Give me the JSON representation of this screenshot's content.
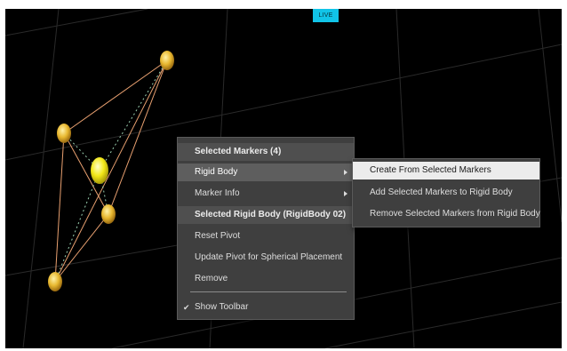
{
  "viewport": {
    "status_badge": "LIVE"
  },
  "context_menu": {
    "header_markers": "Selected Markers (4)",
    "items_markers": [
      {
        "label": "Rigid Body",
        "has_submenu": true,
        "highlighted": true
      },
      {
        "label": "Marker Info",
        "has_submenu": true,
        "highlighted": false
      }
    ],
    "header_rigid_body": "Selected Rigid Body (RigidBody 02)",
    "items_rigid_body": [
      {
        "label": "Reset Pivot"
      },
      {
        "label": "Update Pivot for Spherical Placement"
      },
      {
        "label": "Remove"
      }
    ],
    "show_toolbar": {
      "label": "Show Toolbar",
      "checked": true
    }
  },
  "submenu": {
    "items": [
      {
        "label": "Create From Selected Markers",
        "highlighted": true
      },
      {
        "label": "Add Selected Markers to Rigid Body",
        "highlighted": false
      },
      {
        "label": "Remove Selected Markers from Rigid Body",
        "highlighted": false
      }
    ]
  },
  "colors": {
    "background": "#000000",
    "marker": "#e8b830",
    "marker_selected": "#f2e818",
    "bone_line": "#e8a070",
    "grid_line": "#2a2a2a",
    "live_badge": "#11c4e8",
    "menu_bg": "#3f3f3f"
  }
}
